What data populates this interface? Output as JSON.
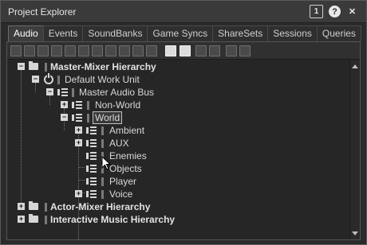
{
  "window": {
    "title": "Project Explorer",
    "buttons": [
      {
        "name": "layout-1-button",
        "glyph": "1"
      },
      {
        "name": "help-button",
        "glyph": "?"
      },
      {
        "name": "close-button",
        "glyph": "✕"
      }
    ]
  },
  "tabs": [
    {
      "label": "Audio",
      "active": true
    },
    {
      "label": "Events"
    },
    {
      "label": "SoundBanks"
    },
    {
      "label": "Game Syncs"
    },
    {
      "label": "ShareSets"
    },
    {
      "label": "Sessions"
    },
    {
      "label": "Queries"
    }
  ],
  "toolbar_icons": [
    "work-unit-icon",
    "folder-icon",
    "new-folder-icon",
    "add-child-icon",
    "bus-icon",
    "aux-bus-icon",
    "random-container-icon",
    "switch-container-icon",
    "blend-container-icon",
    "sound-icon",
    "cut-icon",
    "copy-icon",
    "paste-icon",
    "delete-icon",
    "rename-icon",
    "grid-icon",
    "expand-icon"
  ],
  "tree": {
    "master_mixer": "Master-Mixer Hierarchy",
    "default_work_unit": "Default Work Unit",
    "master_audio_bus": "Master Audio Bus",
    "non_world": "Non-World",
    "world": "World",
    "ambient": "Ambient",
    "aux": "AUX",
    "enemies": "Enemies",
    "objects": "Objects",
    "player": "Player",
    "voice": "Voice",
    "actor_mixer": "Actor-Mixer Hierarchy",
    "interactive_music": "Interactive Music Hierarchy"
  },
  "expanders": {
    "collapsed": "+",
    "expanded": "−"
  }
}
